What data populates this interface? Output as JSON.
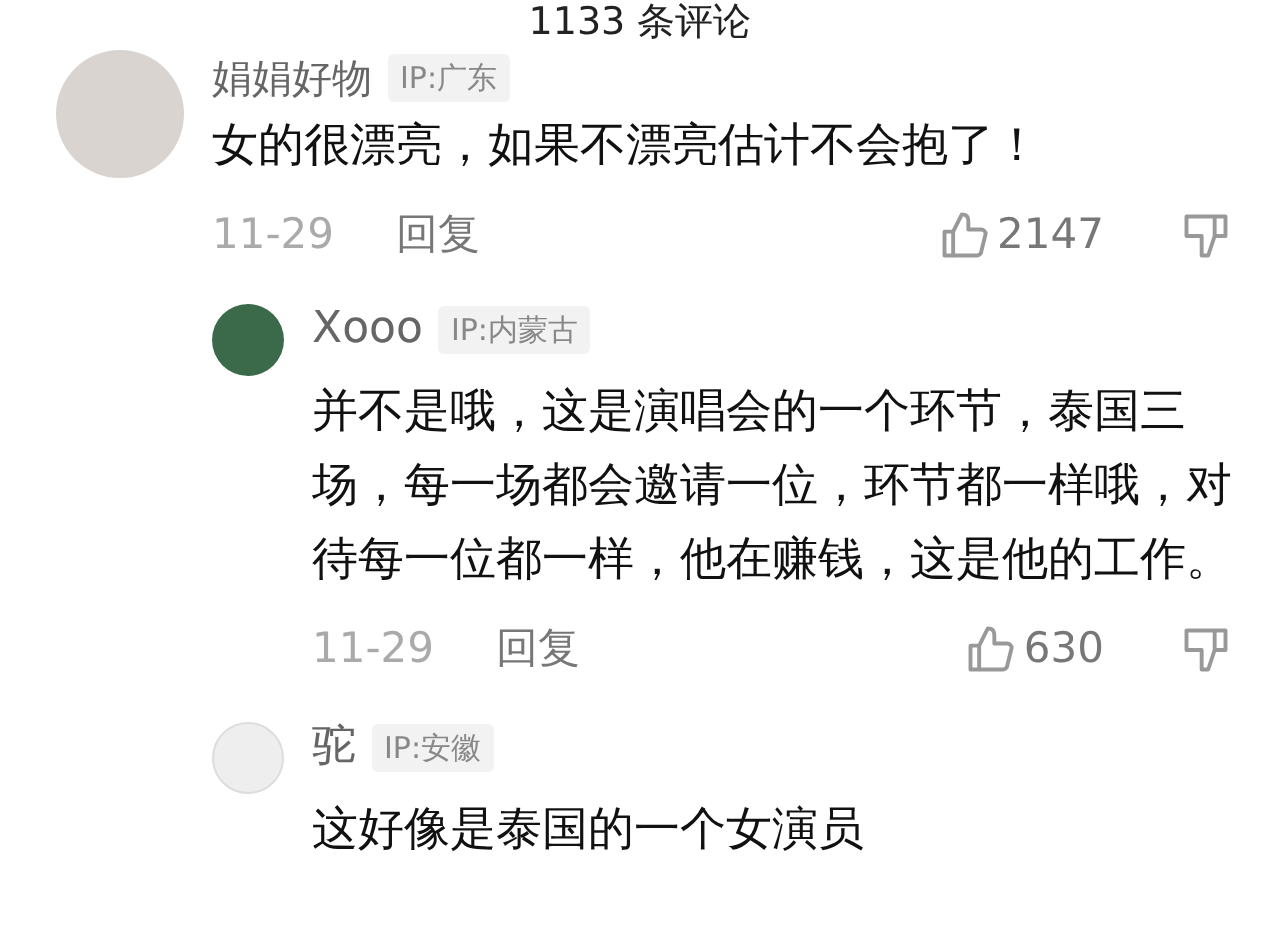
{
  "header": {
    "title": "1133 条评论"
  },
  "comments": [
    {
      "username": "娟娟好物",
      "ip": "IP:广东",
      "text": "女的很漂亮，如果不漂亮估计不会抱了！",
      "date": "11-29",
      "reply_label": "回复",
      "likes": "2147",
      "replies": [
        {
          "username": "Xooo",
          "ip": "IP:内蒙古",
          "text": "并不是哦，这是演唱会的一个环节，泰国三场，每一场都会邀请一位，环节都一样哦，对待每一位都一样，他在赚钱，这是他的工作。",
          "date": "11-29",
          "reply_label": "回复",
          "likes": "630"
        },
        {
          "username": "驼",
          "ip": "IP:安徽",
          "text": "这好像是泰国的一个女演员"
        }
      ]
    }
  ]
}
